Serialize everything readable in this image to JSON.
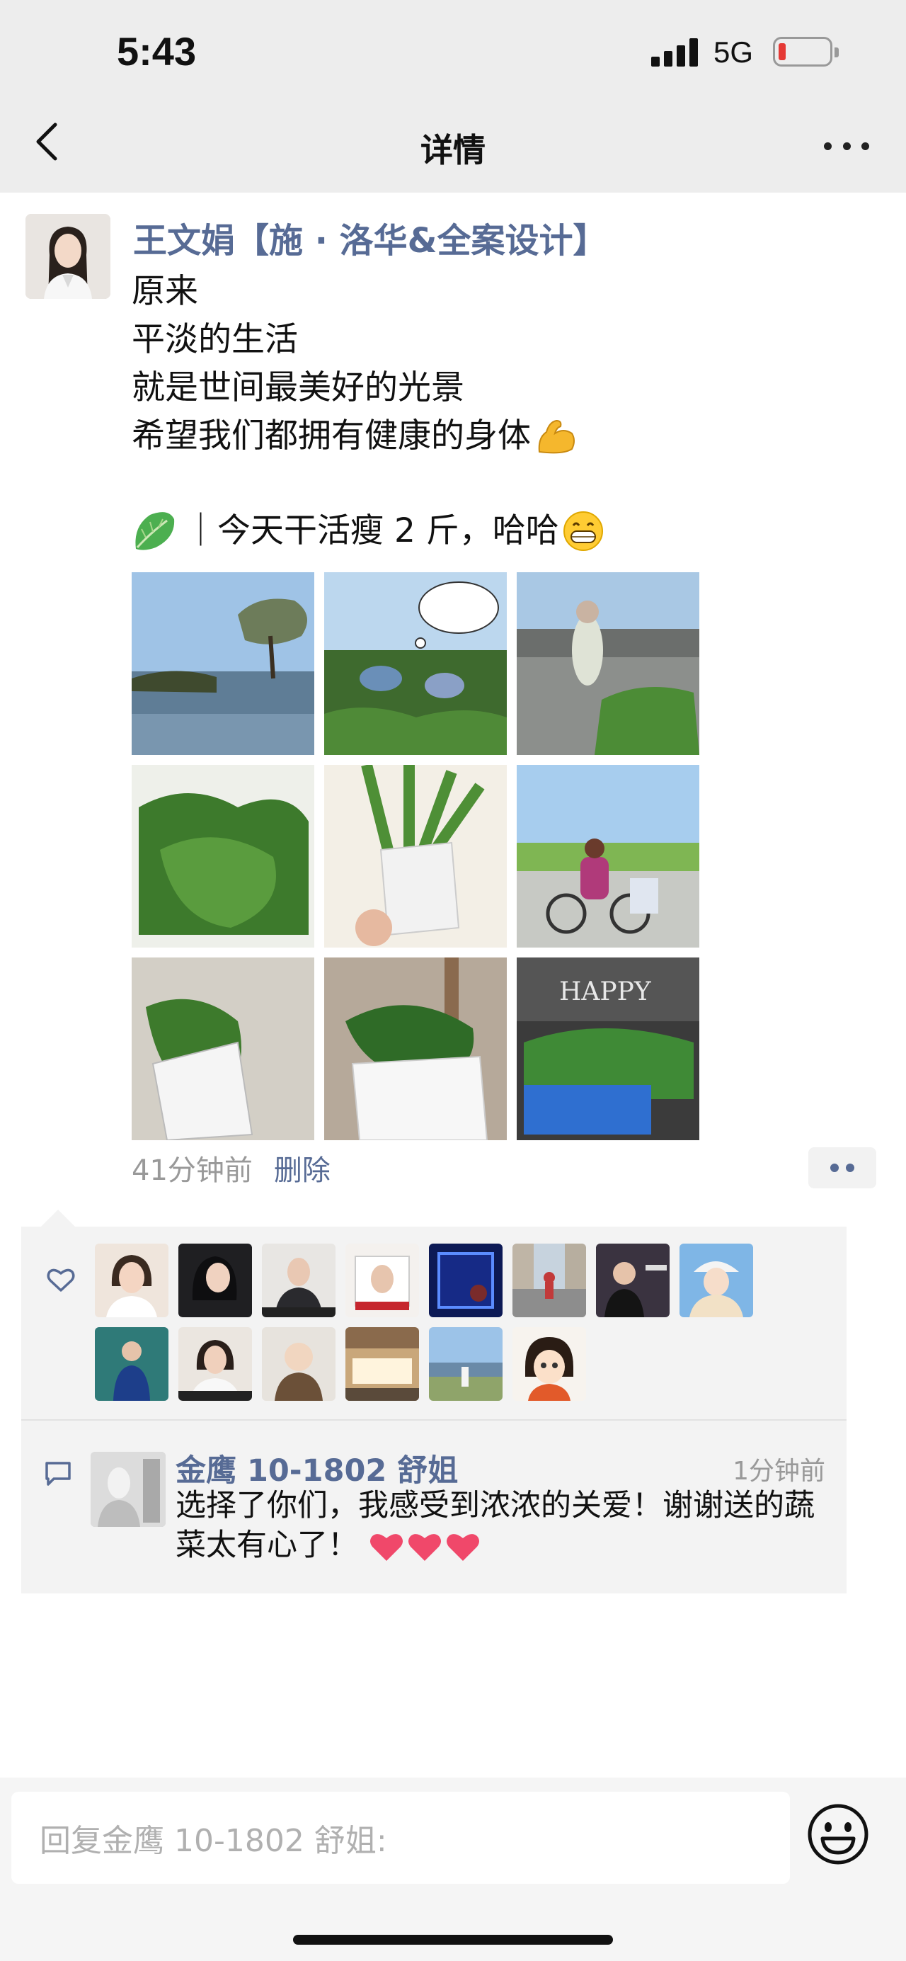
{
  "status_bar": {
    "time": "5:43",
    "network": "5G"
  },
  "nav": {
    "title": "详情"
  },
  "post": {
    "author": "王文娟【施 · 洛华&全案设计】",
    "lines": [
      "原来",
      "平淡的生活",
      "就是世间最美好的光景",
      "希望我们都拥有健康的身体"
    ],
    "last_line": "｜今天干活瘦 2 斤，哈哈",
    "time_ago": "41分钟前",
    "delete_label": "删除",
    "photo_count": 9
  },
  "likes": {
    "count": 14
  },
  "comment": {
    "author": "金鹰 10-1802 舒姐",
    "time": "1分钟前",
    "text": "选择了你们，我感受到浓浓的关爱！谢谢送的蔬菜太有心了！"
  },
  "reply": {
    "placeholder": "回复金鹰 10-1802 舒姐:"
  },
  "colors": {
    "link_blue": "#576b95",
    "top_bg": "#ededed",
    "panel_bg": "#f3f3f3"
  }
}
